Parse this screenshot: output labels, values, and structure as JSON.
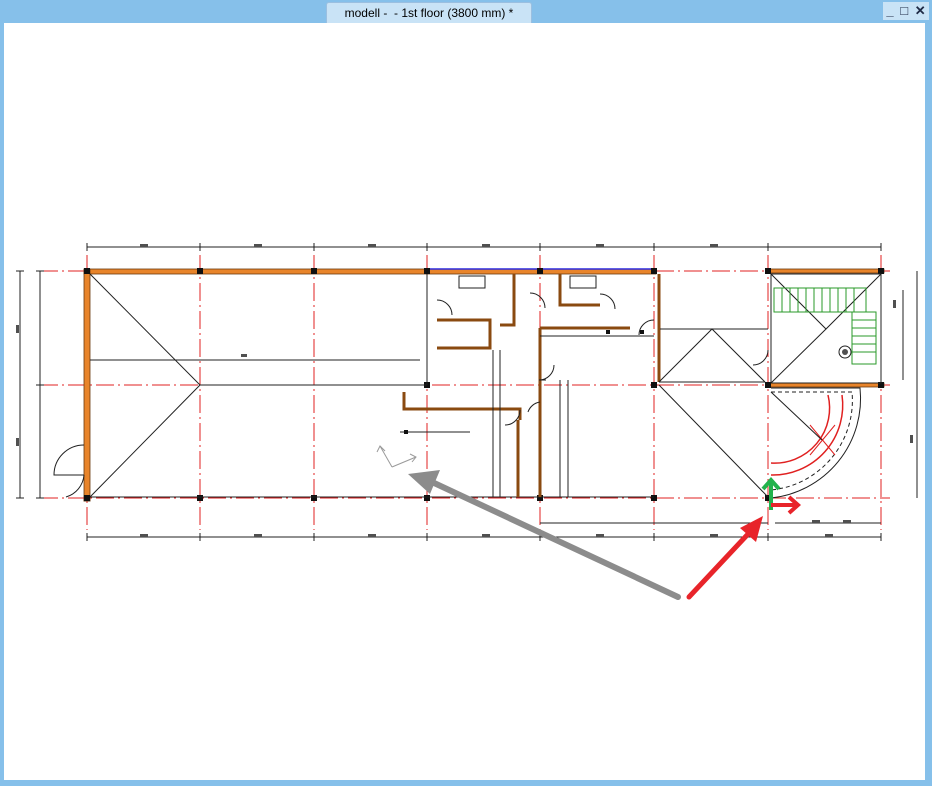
{
  "window": {
    "title": "modell -  - 1st floor (3800 mm) *"
  },
  "controls": {
    "minimize": "_",
    "maximize": "□",
    "close": "✕"
  },
  "colors": {
    "wall": "#e8842a",
    "axis": "#e02020",
    "dimension": "#202020",
    "stair": "#2a9a2a",
    "annotation_gray": "#8c8c8c",
    "annotation_red": "#e8242a",
    "coord_y": "#22b24c",
    "coord_x": "#e8242a"
  },
  "icons": [
    "minimize-icon",
    "maximize-icon",
    "close-icon",
    "coordinate-system-icon",
    "coordinate-axes-icon"
  ]
}
